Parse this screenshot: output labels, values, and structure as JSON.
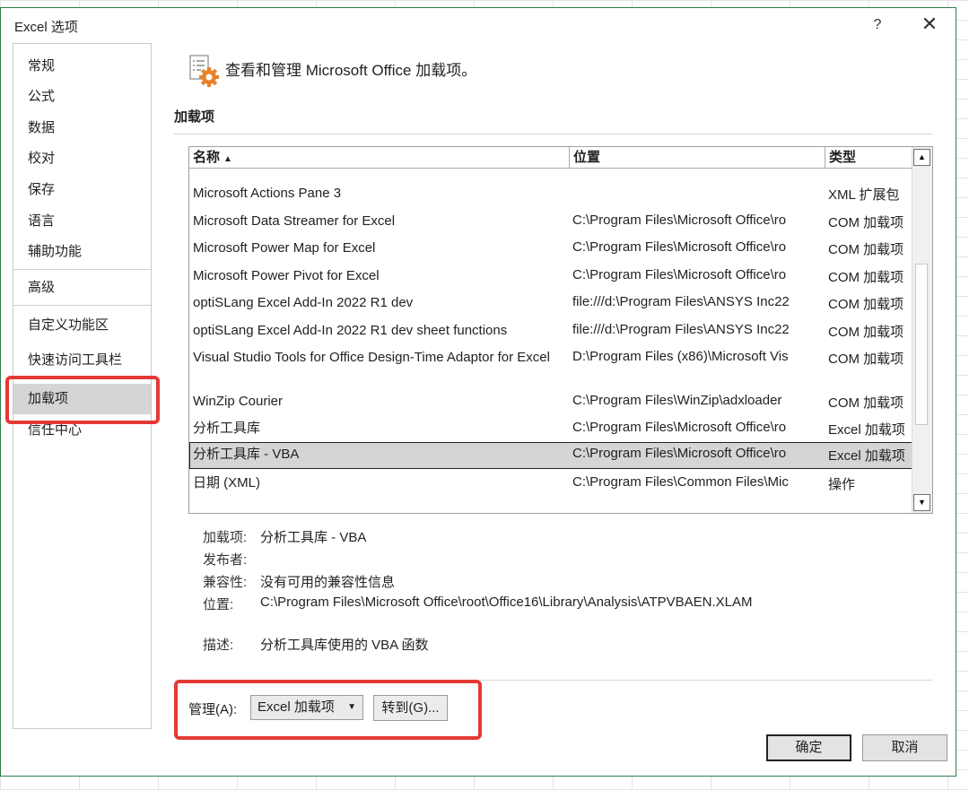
{
  "window": {
    "title": "Excel 选项",
    "help": "?",
    "close": "✕"
  },
  "nav": {
    "items": [
      {
        "label": "常规"
      },
      {
        "label": "公式"
      },
      {
        "label": "数据"
      },
      {
        "label": "校对"
      },
      {
        "label": "保存"
      },
      {
        "label": "语言"
      },
      {
        "label": "辅助功能"
      },
      {
        "label": "高级"
      },
      {
        "label": "自定义功能区"
      },
      {
        "label": "快速访问工具栏"
      },
      {
        "label": "加载项"
      },
      {
        "label": "信任中心"
      }
    ],
    "selected": "加载项"
  },
  "header": {
    "icon": "addins-gear-icon",
    "text": "查看和管理 Microsoft Office 加载项。"
  },
  "section": {
    "title": "加载项"
  },
  "table": {
    "columns": {
      "name": "名称",
      "location": "位置",
      "type": "类型"
    },
    "sort_indicator": "▲",
    "rows": [
      {
        "name": "Microsoft Actions Pane 3",
        "location": "",
        "type": "XML 扩展包"
      },
      {
        "name": "Microsoft Data Streamer for Excel",
        "location": "C:\\Program Files\\Microsoft Office\\ro",
        "type": "COM 加载项"
      },
      {
        "name": "Microsoft Power Map for Excel",
        "location": "C:\\Program Files\\Microsoft Office\\ro",
        "type": "COM 加载项"
      },
      {
        "name": "Microsoft Power Pivot for Excel",
        "location": "C:\\Program Files\\Microsoft Office\\ro",
        "type": "COM 加载项"
      },
      {
        "name": "optiSLang Excel Add-In 2022 R1 dev",
        "location": "file:///d:\\Program Files\\ANSYS Inc22",
        "type": "COM 加载项"
      },
      {
        "name": "optiSLang Excel Add-In 2022 R1 dev sheet functions",
        "location": "file:///d:\\Program Files\\ANSYS Inc22",
        "type": "COM 加载项"
      },
      {
        "name": "Visual Studio Tools for Office Design-Time Adaptor for Excel",
        "location": "D:\\Program Files (x86)\\Microsoft Vis",
        "type": "COM 加载项"
      },
      {
        "name": "WinZip Courier",
        "location": "C:\\Program Files\\WinZip\\adxloader",
        "type": "COM 加载项"
      },
      {
        "name": "分析工具库",
        "location": "C:\\Program Files\\Microsoft Office\\ro",
        "type": "Excel 加载项"
      },
      {
        "name": "分析工具库 - VBA",
        "location": "C:\\Program Files\\Microsoft Office\\ro",
        "type": "Excel 加载项"
      },
      {
        "name": "日期 (XML)",
        "location": "C:\\Program Files\\Common Files\\Mic",
        "type": "操作"
      }
    ],
    "selected_index": 9
  },
  "details": {
    "addin_label": "加载项:",
    "addin_value": "分析工具库 - VBA",
    "publisher_label": "发布者:",
    "publisher_value": "",
    "compat_label": "兼容性:",
    "compat_value": "没有可用的兼容性信息",
    "location_label": "位置:",
    "location_value": "C:\\Program Files\\Microsoft Office\\root\\Office16\\Library\\Analysis\\ATPVBAEN.XLAM",
    "desc_label": "描述:",
    "desc_value": "分析工具库使用的 VBA 函数"
  },
  "manage": {
    "label": "管理(A):",
    "selected": "Excel 加载项",
    "go_button": "转到(G)..."
  },
  "buttons": {
    "ok": "确定",
    "cancel": "取消"
  },
  "colors": {
    "highlight_box": "#e53935",
    "selection": "#d5d5d5",
    "window_border": "#2e7d4a"
  }
}
